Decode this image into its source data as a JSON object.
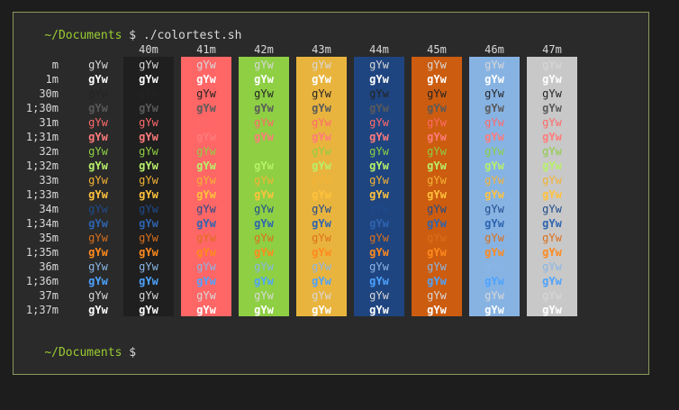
{
  "prompt_line_1": {
    "path": "~/Documents",
    "rest": " $ ./colortest.sh"
  },
  "prompt_line_2": {
    "path": "~/Documents",
    "rest": " $"
  },
  "sample_text": "gYw",
  "headers": [
    "40m",
    "41m",
    "42m",
    "43m",
    "44m",
    "45m",
    "46m",
    "47m"
  ],
  "row_labels": [
    "m",
    "1m",
    "30m",
    "1;30m",
    "31m",
    "1;31m",
    "32m",
    "1;32m",
    "33m",
    "1;33m",
    "34m",
    "1;34m",
    "35m",
    "1;35m",
    "36m",
    "1;36m",
    "37m",
    "1;37m"
  ],
  "colors": {
    "terminal_bg": "#2a2a2a",
    "border": "#8a9a5b",
    "prompt_path": "#9acd32",
    "bg": [
      "#1f1f1f",
      "#ff6666",
      "#8ecf44",
      "#e9b43e",
      "#1f4580",
      "#cc5c0f",
      "#87b3e3",
      "#c8c8c8"
    ],
    "fg_normal": [
      "#d8d8d8",
      "#242424",
      "#ff6a6a",
      "#8ecf44",
      "#f4b335",
      "#1f4b8c",
      "#dc6f1a",
      "#8ab6e6",
      "#d8d8d8"
    ],
    "fg_bright": [
      "#ffffff",
      "#5a5a5a",
      "#ff7b7b",
      "#b8f06a",
      "#ffc23c",
      "#2e64b0",
      "#ff8a1e",
      "#4da3ff",
      "#ffffff"
    ]
  }
}
